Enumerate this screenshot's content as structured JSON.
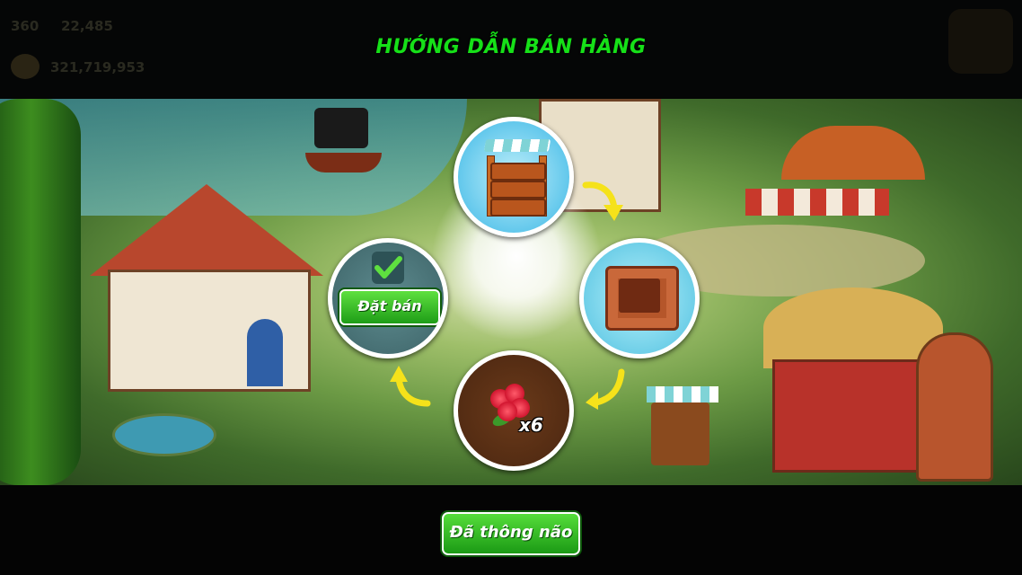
{
  "title": "HƯỚNG DẪN BÁN HÀNG",
  "hud": {
    "level_text": "360",
    "xp_text": "22,485",
    "coins_text": "321,719,953"
  },
  "steps": [
    {
      "id": "market-stand",
      "icon": "market-stand-icon"
    },
    {
      "id": "empty-crate",
      "icon": "empty-crate-icon"
    },
    {
      "id": "rose-item",
      "icon": "rose-icon",
      "quantity_label": "x6"
    },
    {
      "id": "sell-action",
      "icon": "checkmark-icon",
      "button_label": "Đặt bán"
    }
  ],
  "confirm_button_label": "Đã thông não",
  "colors": {
    "title_green": "#16e018",
    "button_green": "#1e9d17",
    "arrow_yellow": "#f5e21a",
    "circle_border": "#ffffff"
  }
}
